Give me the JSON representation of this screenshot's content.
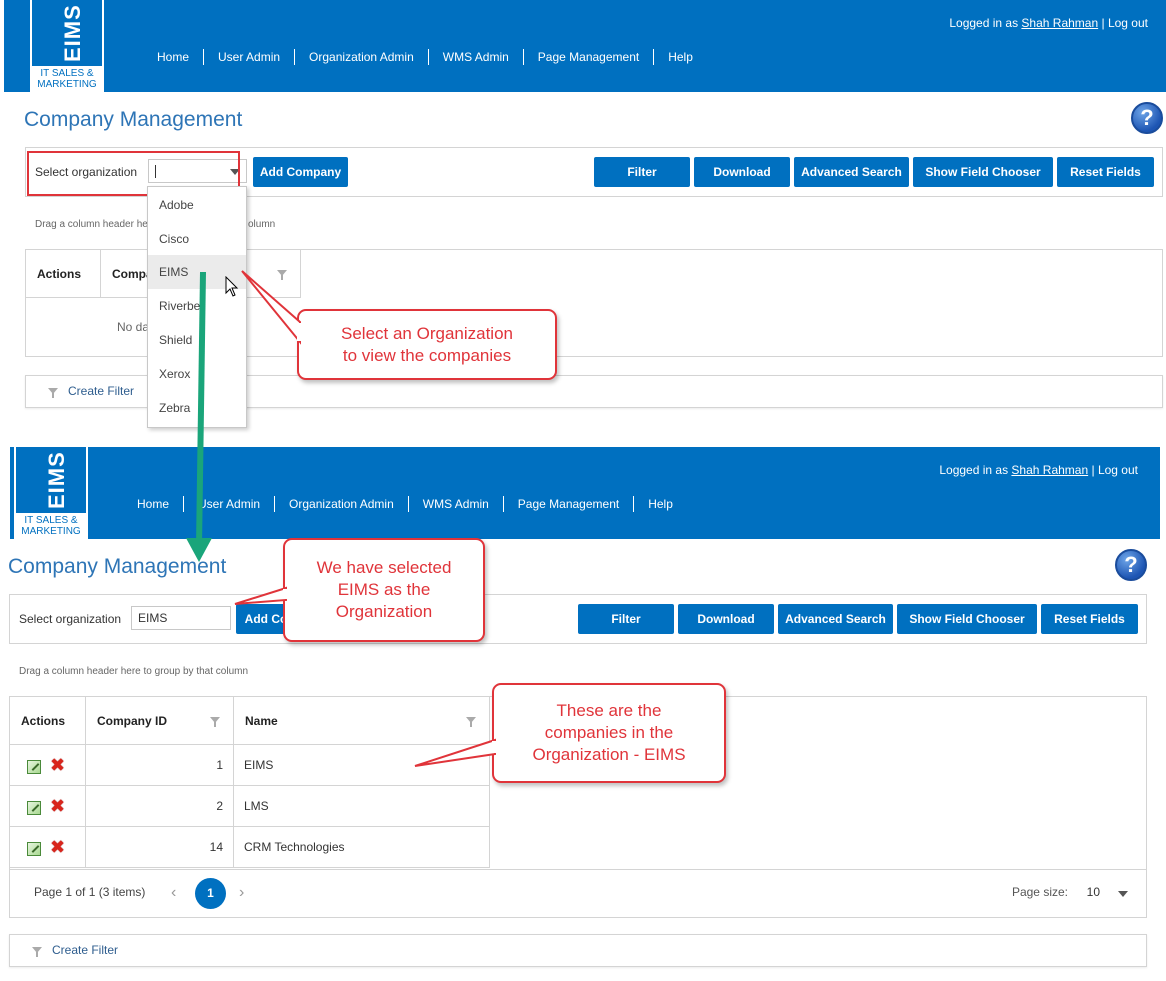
{
  "brand": {
    "logo_word": "EIMS",
    "tagline_1": "IT SALES &",
    "tagline_2": "MARKETING"
  },
  "nav": [
    "Home",
    "User Admin",
    "Organization Admin",
    "WMS Admin",
    "Page Management",
    "Help"
  ],
  "login": {
    "prefix": "Logged in as",
    "user": "Shah Rahman",
    "separator": "|",
    "logout": "Log out"
  },
  "page_title": "Company Management",
  "help_label": "?",
  "toolbar": {
    "select_label": "Select organization",
    "selected_value": "EIMS",
    "add_company": "Add Company",
    "buttons": [
      "Filter",
      "Download",
      "Advanced Search",
      "Show Field Chooser",
      "Reset Fields"
    ]
  },
  "group_hint": "Drag a column header here to group by that column",
  "panel1": {
    "hint_visible_left": "Drag a column header he",
    "hint_visible_right": "olumn",
    "col_actions": "Actions",
    "col_company_partial": "Compa",
    "no_data_partial": "No da",
    "dropdown_options": [
      "Adobe",
      "Cisco",
      "EIMS",
      "Riverbed",
      "Shield",
      "Xerox",
      "Zebra"
    ],
    "dropdown_visible": [
      "Adobe",
      "Cisco",
      "EIMS",
      "Riverbe",
      "Shield",
      "Xerox",
      "Zebra"
    ],
    "highlighted_option": "EIMS"
  },
  "grid": {
    "columns": [
      "Actions",
      "Company ID",
      "Name"
    ],
    "rows": [
      {
        "id": "1",
        "name": "EIMS"
      },
      {
        "id": "2",
        "name": "LMS"
      },
      {
        "id": "14",
        "name": "CRM Technologies"
      }
    ],
    "add_partial": "Add Co"
  },
  "pager": {
    "info": "Page 1 of 1 (3 items)",
    "current_page": "1",
    "page_size_label": "Page size:",
    "page_size": "10"
  },
  "create_filter": "Create Filter",
  "callouts": {
    "select_org": [
      "Select an Organization",
      "to view the companies"
    ],
    "selected": [
      "We have selected",
      "EIMS as the",
      "Organization"
    ],
    "companies": [
      "These are the",
      "companies in the",
      "Organization - EIMS"
    ]
  },
  "colors": {
    "header_blue": "#0070c0",
    "title_blue": "#2e75b6",
    "callout_red": "#e0343a",
    "arrow_green": "#1aa57a"
  }
}
